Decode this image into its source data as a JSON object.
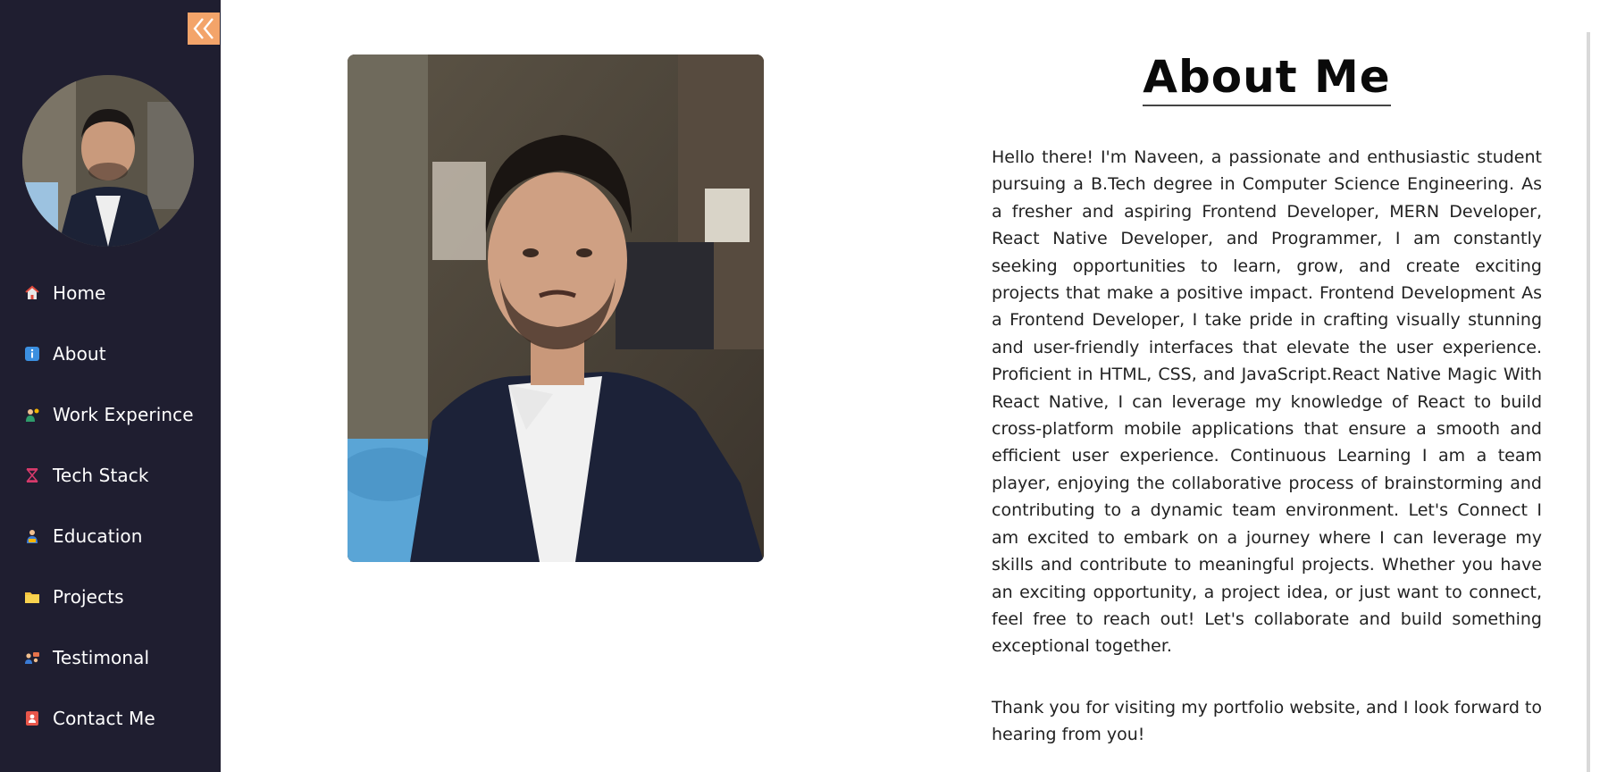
{
  "sidebar": {
    "collapse_icon": "double-chevron-left-icon",
    "accent": "#f3a46a",
    "background": "#1f1e30",
    "items": [
      {
        "label": "Home",
        "icon": "home-icon"
      },
      {
        "label": "About",
        "icon": "info-icon"
      },
      {
        "label": "Work Experince",
        "icon": "worker-icon"
      },
      {
        "label": "Tech Stack",
        "icon": "hourglass-icon"
      },
      {
        "label": "Education",
        "icon": "student-icon"
      },
      {
        "label": "Projects",
        "icon": "folder-icon"
      },
      {
        "label": "Testimonal",
        "icon": "people-icon"
      },
      {
        "label": "Contact Me",
        "icon": "contact-book-icon"
      }
    ]
  },
  "about": {
    "title": "About Me",
    "bio": "Hello there! I'm Naveen, a passionate and enthusiastic student pursuing a B.Tech degree in Computer Science Engineering. As a fresher and aspiring Frontend Developer, MERN Developer, React Native Developer, and Programmer, I am constantly seeking opportunities to learn, grow, and create exciting projects that make a positive impact. Frontend Development As a Frontend Developer, I take pride in crafting visually stunning and user-friendly interfaces that elevate the user experience. Proficient in HTML, CSS, and JavaScript.React Native Magic With React Native, I can leverage my knowledge of React to build cross-platform mobile applications that ensure a smooth and efficient user experience. Continuous Learning I am a team player, enjoying the collaborative process of brainstorming and contributing to a dynamic team environment. Let's Connect I am excited to embark on a journey where I can leverage my skills and contribute to meaningful projects. Whether you have an exciting opportunity, a project idea, or just want to connect, feel free to reach out! Let's collaborate and build something exceptional together.",
    "thanks": "Thank you for visiting my portfolio website, and I look forward to hearing from you!"
  }
}
